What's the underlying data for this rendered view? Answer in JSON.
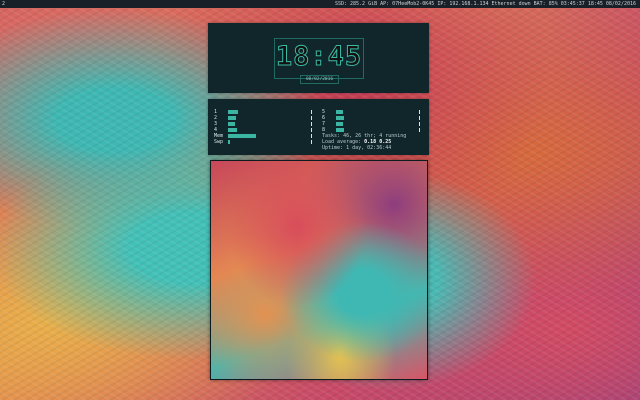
{
  "topbar": {
    "workspace": "2",
    "status_text": "SSD: 285.2 GiB  AP: 07HeeMob2-0K45  IP: 192.168.1.134  Ethernet down  BAT: 85%  03:45:37  18:45  08/02/2016"
  },
  "clock": {
    "time": "18:45",
    "date": "08/02/2016"
  },
  "system_info": {
    "cpu_bars": [
      {
        "label": "1",
        "fraction": 0.12
      },
      {
        "label": "2",
        "fraction": 0.1
      },
      {
        "label": "3",
        "fraction": 0.08
      },
      {
        "label": "4",
        "fraction": 0.11
      }
    ],
    "memory_bars": [
      {
        "label": "Mem",
        "fraction": 0.34
      },
      {
        "label": "Swp",
        "fraction": 0.02
      }
    ],
    "right_bars": [
      {
        "label": "5",
        "fraction": 0.09
      },
      {
        "label": "6",
        "fraction": 0.1
      },
      {
        "label": "7",
        "fraction": 0.08
      },
      {
        "label": "8",
        "fraction": 0.1
      }
    ],
    "tasks_line": "Tasks: 46, 26 thr; 4 running",
    "load_prefix": "Load average:",
    "load_values": "0.18 0.25",
    "uptime_line": "Uptime: 1 day, 02:36:44"
  },
  "colors": {
    "accent": "#39b9a6",
    "panel_bg": "#10262a",
    "bar_bg": "#1a2027"
  }
}
